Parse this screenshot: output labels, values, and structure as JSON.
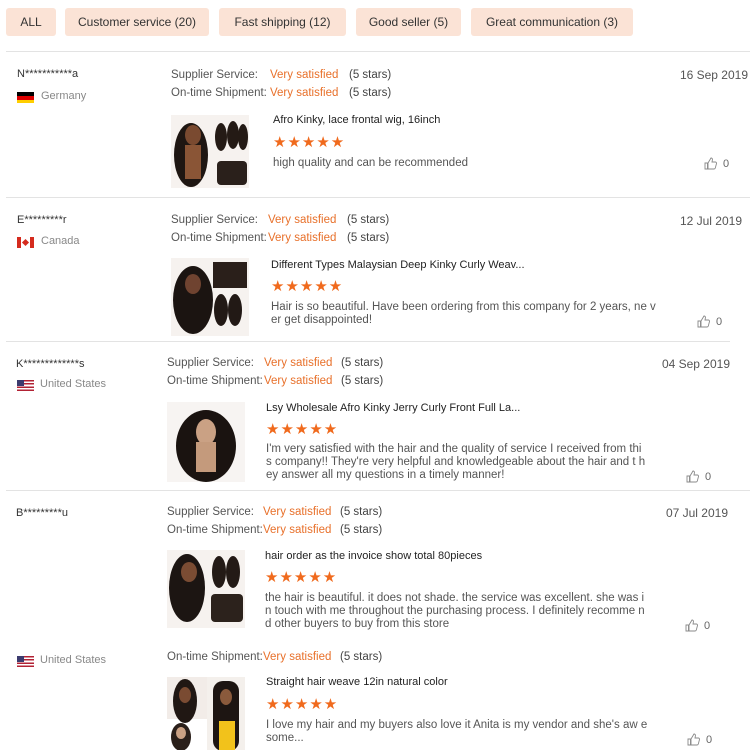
{
  "filters": [
    {
      "label": "ALL"
    },
    {
      "label": "Customer service (20)"
    },
    {
      "label": "Fast shipping (12)"
    },
    {
      "label": "Good seller (5)"
    },
    {
      "label": "Great communication (3)"
    }
  ],
  "labels": {
    "supplier": "Supplier Service:",
    "shipment": "On-time Shipment:"
  },
  "reviews": [
    {
      "user": "N***********a",
      "country": "Germany",
      "flag": "germany-flag-icon",
      "supplier_value": "Very satisfied",
      "supplier_stars": "(5 stars)",
      "shipment_value": "Very satisfied",
      "shipment_stars": "(5 stars)",
      "date": "16 Sep 2019",
      "product_title": "Afro Kinky, lace frontal wig, 16inch",
      "rating": "★★★★★",
      "text": "high quality and can be recommended",
      "likes": "0"
    },
    {
      "user": "E*********r",
      "country": "Canada",
      "flag": "canada-flag-icon",
      "supplier_value": "Very satisfied",
      "supplier_stars": "(5 stars)",
      "shipment_value": "Very satisfied",
      "shipment_stars": "(5 stars)",
      "date": "12 Jul 2019",
      "product_title": "Different Types Malaysian Deep Kinky Curly Weav...",
      "rating": "★★★★★",
      "text": "Hair is so beautiful. Have been ordering from this company for 2 years, ne ver get disappointed!",
      "likes": "0"
    },
    {
      "user": "K*************s",
      "country": "United States",
      "flag": "usa-flag-icon",
      "supplier_value": "Very satisfied",
      "supplier_stars": "(5 stars)",
      "shipment_value": "Very satisfied",
      "shipment_stars": "(5 stars)",
      "date": "04 Sep 2019",
      "product_title": "Lsy Wholesale Afro Kinky Jerry Curly Front Full La...",
      "rating": "★★★★★",
      "text": "I'm very satisfied with the hair and the quality of service I received from thi s company!! They're very helpful and knowledgeable about the hair and t hey answer all my questions in a timely manner!",
      "likes": "0"
    },
    {
      "user": "B*********u",
      "country": "",
      "flag": "",
      "supplier_value": "Very satisfied",
      "supplier_stars": "(5 stars)",
      "shipment_value": "Very satisfied",
      "shipment_stars": "(5 stars)",
      "date": "07 Jul 2019",
      "product_title": "hair order as the invoice show total 80pieces",
      "rating": "★★★★★",
      "text": "the hair is beautiful. it does not shade. the service was excellent. she was in touch with me throughout the purchasing process. I definitely recomme nd other buyers to buy from this store",
      "likes": "0"
    },
    {
      "user": "",
      "country": "United States",
      "flag": "usa-flag-icon",
      "supplier_value": "",
      "supplier_stars": "",
      "shipment_value": "Very satisfied",
      "shipment_stars": "(5 stars)",
      "date": "",
      "product_title": "Straight hair weave 12in natural color",
      "rating": "★★★★★",
      "text": "I love my hair and my buyers also love it Anita is my vendor and she's aw esome...",
      "likes": "0"
    }
  ],
  "colors": {
    "accent": "#e8702a",
    "star": "#f06a1d",
    "chip_bg": "#fbe3d6"
  }
}
